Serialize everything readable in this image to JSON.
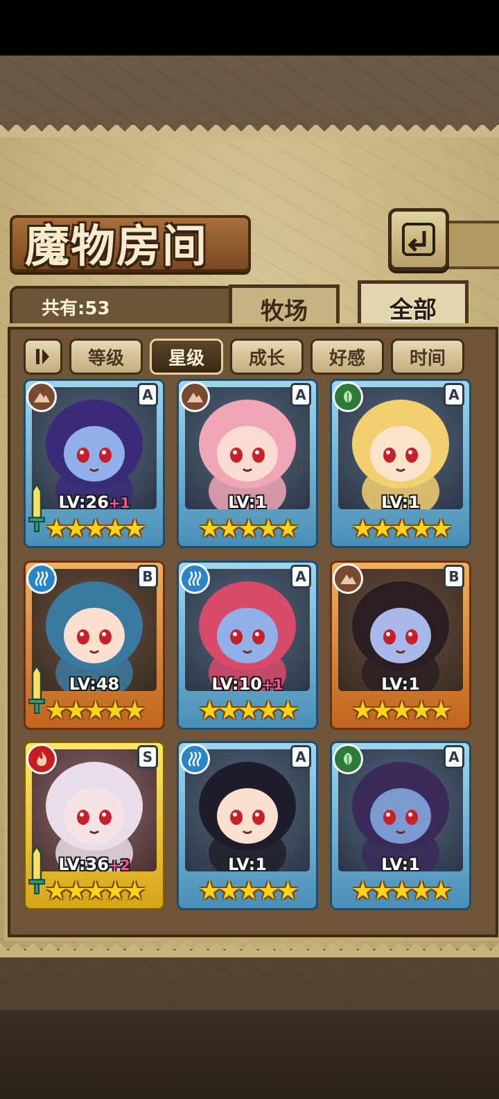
{
  "header": {
    "title": "魔物房间",
    "back_icon": "back-arrow-icon"
  },
  "summary": {
    "count_label": "共有:53"
  },
  "tabs": [
    {
      "label": "牧场",
      "active": false
    },
    {
      "label": "全部",
      "active": true
    }
  ],
  "sort": {
    "toggle_icon": "sort-order-icon",
    "buttons": [
      {
        "label": "等级",
        "active": false
      },
      {
        "label": "星级",
        "active": true
      },
      {
        "label": "成长",
        "active": false
      },
      {
        "label": "好感",
        "active": false
      },
      {
        "label": "时间",
        "active": false
      }
    ]
  },
  "monsters": [
    {
      "element": "earth",
      "rank": "A",
      "frame": "blue",
      "level": "LV:26",
      "bonus": "+1",
      "stars": 5,
      "weapon": true,
      "hair": "#3b2a7a",
      "skin": "#8fb0e8"
    },
    {
      "element": "earth",
      "rank": "A",
      "frame": "blue",
      "level": "LV:1",
      "bonus": "",
      "stars": 5,
      "weapon": false,
      "hair": "#f0a6b4",
      "skin": "#f8dcd2"
    },
    {
      "element": "nature",
      "rank": "A",
      "frame": "blue",
      "level": "LV:1",
      "bonus": "",
      "stars": 5,
      "weapon": false,
      "hair": "#f2d070",
      "skin": "#fbe4cc"
    },
    {
      "element": "water",
      "rank": "B",
      "frame": "orange",
      "level": "LV:48",
      "bonus": "",
      "stars": 5,
      "weapon": true,
      "hair": "#3a7aa0",
      "skin": "#fbe0d0"
    },
    {
      "element": "water",
      "rank": "A",
      "frame": "blue",
      "level": "LV:10",
      "bonus": "+1",
      "stars": 5,
      "weapon": false,
      "hair": "#d84a6a",
      "skin": "#8fb0e8"
    },
    {
      "element": "earth",
      "rank": "B",
      "frame": "orange",
      "level": "LV:1",
      "bonus": "",
      "stars": 5,
      "weapon": false,
      "hair": "#2a1e22",
      "skin": "#a8b8e8"
    },
    {
      "element": "fire",
      "rank": "S",
      "frame": "gold",
      "level": "LV:36",
      "bonus": "+2",
      "stars": 5,
      "weapon": true,
      "hair": "#e8dde8",
      "skin": "#f6e4e4"
    },
    {
      "element": "water",
      "rank": "A",
      "frame": "blue",
      "level": "LV:1",
      "bonus": "",
      "stars": 5,
      "weapon": false,
      "hair": "#1e1e2a",
      "skin": "#fbe0d0"
    },
    {
      "element": "nature",
      "rank": "A",
      "frame": "blue",
      "level": "LV:1",
      "bonus": "",
      "stars": 5,
      "weapon": false,
      "hair": "#3a2a5a",
      "skin": "#7a9ad0"
    }
  ]
}
